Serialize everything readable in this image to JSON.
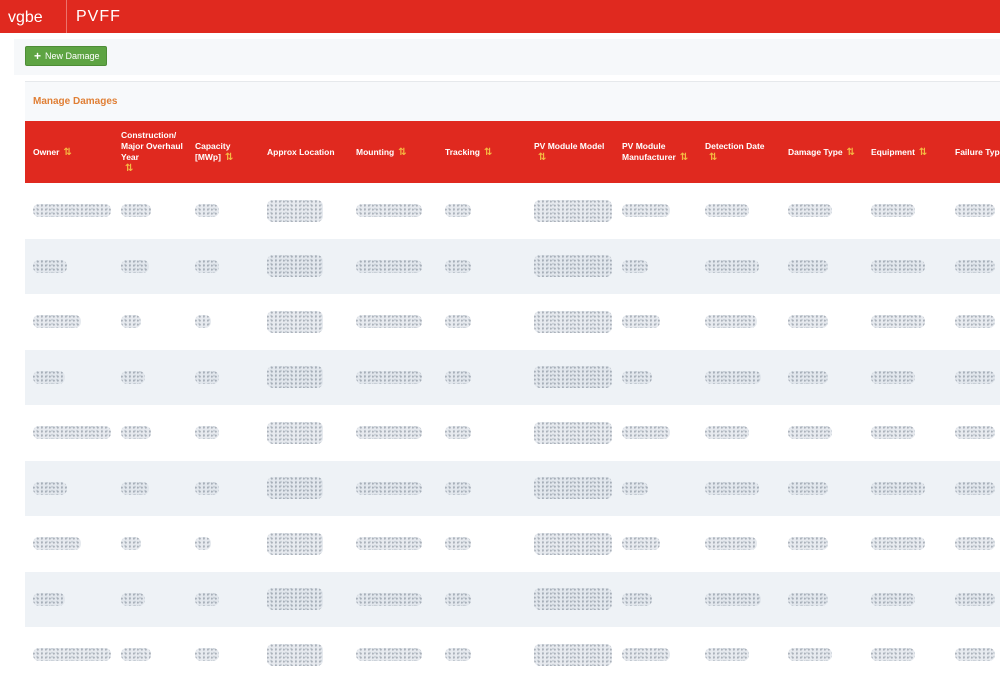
{
  "app": {
    "logo_text": "vgbe",
    "name": "PVFF",
    "brand_color": "#e0291f"
  },
  "toolbar": {
    "new_damage_label": "New Damage",
    "new_damage_icon": "plus-icon",
    "button_color": "#5ea443"
  },
  "panel": {
    "title": "Manage Damages",
    "title_color": "#e07f35"
  },
  "table": {
    "sort_icon": "⇅",
    "columns": [
      {
        "label": "Owner"
      },
      {
        "label": "Construction/ Major Overhaul Year"
      },
      {
        "label": "Capacity [MWp]"
      },
      {
        "label": "Approx Location"
      },
      {
        "label": "Mounting"
      },
      {
        "label": "Tracking"
      },
      {
        "label": "PV Module Model"
      },
      {
        "label": "PV Module Manufacturer"
      },
      {
        "label": "Detection Date"
      },
      {
        "label": "Damage Type"
      },
      {
        "label": "Equipment"
      },
      {
        "label": "Failure Type"
      }
    ],
    "row_count": 9,
    "cell_content": "redacted (blurred)"
  }
}
